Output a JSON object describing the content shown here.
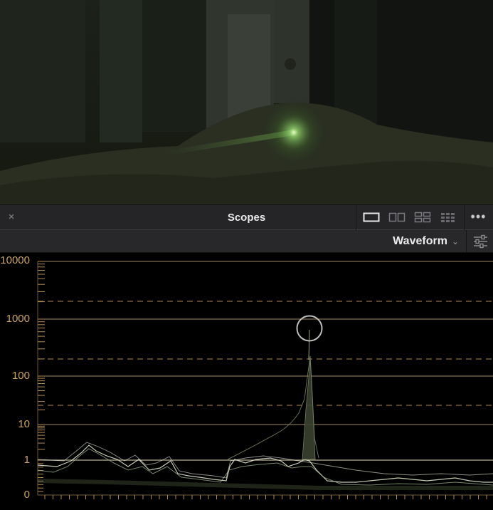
{
  "panel": {
    "title": "Scopes",
    "close_glyph": "×",
    "more_glyph": "•••"
  },
  "layout_options": [
    {
      "name": "single-layout",
      "icon": "single-view-icon",
      "selected": true
    },
    {
      "name": "dual-layout",
      "icon": "dual-view-icon",
      "selected": false
    },
    {
      "name": "quad-layout",
      "icon": "quad-view-icon",
      "selected": false
    },
    {
      "name": "grid-layout",
      "icon": "grid-view-icon",
      "selected": false
    }
  ],
  "toolbar": {
    "scope_type": "Waveform",
    "settings_icon": "sliders-icon"
  },
  "waveform": {
    "scale": "log",
    "axis_labels": [
      "10000",
      "1000",
      "100",
      "10",
      "1",
      "0"
    ],
    "colors": {
      "axis": "#c9a46c",
      "solid_grid": "#9a8a62",
      "dashed_grid": "#b08a52",
      "trace": "#d8e0c8",
      "highlight_circle": "#bdbdbd"
    }
  }
}
